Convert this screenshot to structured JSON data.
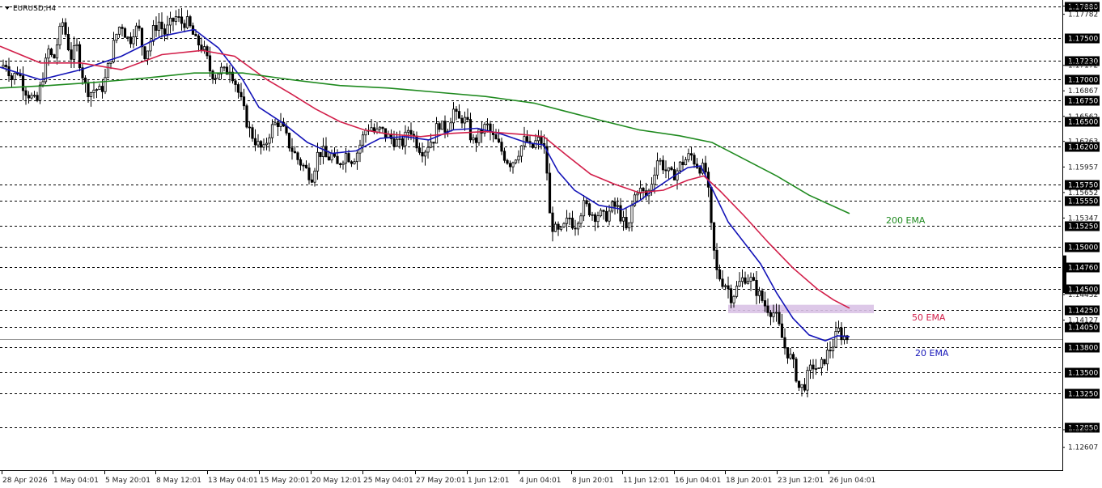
{
  "header": {
    "symbol_label": "EURUSD,H4",
    "menu_icon": "triangle-down-icon"
  },
  "colors": {
    "background": "#ffffff",
    "grid": "#000000",
    "candle": "#000000",
    "ema20": "#1414b8",
    "ema50": "#d21f4a",
    "ema200": "#1f8a1f",
    "zone": "#d9c2e6",
    "price_tag": "#000000",
    "current_price_line": "#9a9a9a"
  },
  "chart_data": {
    "type": "candlestick",
    "title": "",
    "xlabel": "",
    "ylabel": "",
    "symbol": "EURUSD",
    "timeframe": "H4",
    "ylim": [
      1.126,
      1.18
    ],
    "x_ticks": [
      "28 Apr 2026",
      "1 May 04:01",
      "5 May 20:01",
      "8 May 12:01",
      "13 May 04:01",
      "15 May 20:01",
      "20 May 12:01",
      "25 May 04:01",
      "27 May 20:01",
      "1 Jun 12:01",
      "4 Jun 04:01",
      "8 Jun 20:01",
      "11 Jun 12:01",
      "16 Jun 04:01",
      "18 Jun 20:01",
      "23 Jun 12:01",
      "26 Jun 04:01"
    ],
    "y_tick_labels": [
      "1.17880",
      "1.17782",
      "1.17172",
      "1.16867",
      "1.16562",
      "1.16263",
      "1.15957",
      "1.15652",
      "1.15347",
      "1.14432",
      "1.14127",
      "1.12817",
      "1.12607"
    ],
    "y_tick_values": [
      1.1788,
      1.17782,
      1.17172,
      1.16867,
      1.16562,
      1.16263,
      1.15957,
      1.15652,
      1.15347,
      1.14432,
      1.14127,
      1.12817,
      1.12607
    ],
    "levels": [
      1.1788,
      1.175,
      1.1723,
      1.17,
      1.1675,
      1.165,
      1.162,
      1.1575,
      1.1555,
      1.1525,
      1.15,
      1.1476,
      1.145,
      1.1425,
      1.1405,
      1.138,
      1.135,
      1.1325,
      1.1285
    ],
    "level_labels": [
      "1.17880",
      "1.17500",
      "1.17230",
      "1.17000",
      "1.16750",
      "1.16500",
      "1.16200",
      "1.15750",
      "1.15550",
      "1.15250",
      "1.15000",
      "1.14760",
      "1.14500",
      "1.14250",
      "1.14050",
      "1.13800",
      "1.13500",
      "1.13250",
      "1.12850"
    ],
    "current_price": 1.139,
    "resistance_zone": [
      1.1421,
      1.1431
    ],
    "close_path": [
      [
        0,
        1.1715
      ],
      [
        8,
        1.172
      ],
      [
        15,
        1.17
      ],
      [
        22,
        1.1712
      ],
      [
        30,
        1.169
      ],
      [
        38,
        1.168
      ],
      [
        45,
        1.167
      ],
      [
        52,
        1.17
      ],
      [
        60,
        1.1735
      ],
      [
        66,
        1.1722
      ],
      [
        72,
        1.175
      ],
      [
        78,
        1.177
      ],
      [
        83,
        1.1745
      ],
      [
        88,
        1.1728
      ],
      [
        95,
        1.1738
      ],
      [
        100,
        1.1715
      ],
      [
        106,
        1.169
      ],
      [
        112,
        1.1685
      ],
      [
        118,
        1.169
      ],
      [
        124,
        1.1685
      ],
      [
        130,
        1.17
      ],
      [
        135,
        1.172
      ],
      [
        140,
        1.174
      ],
      [
        145,
        1.1758
      ],
      [
        150,
        1.1768
      ],
      [
        155,
        1.1755
      ],
      [
        160,
        1.1745
      ],
      [
        166,
        1.1762
      ],
      [
        172,
        1.1758
      ],
      [
        178,
        1.173
      ],
      [
        184,
        1.174
      ],
      [
        190,
        1.176
      ],
      [
        196,
        1.177
      ],
      [
        203,
        1.1755
      ],
      [
        210,
        1.1765
      ],
      [
        217,
        1.1775
      ],
      [
        224,
        1.1768
      ],
      [
        230,
        1.177
      ],
      [
        236,
        1.176
      ],
      [
        242,
        1.1745
      ],
      [
        248,
        1.1742
      ],
      [
        254,
        1.173
      ],
      [
        260,
        1.171
      ],
      [
        266,
        1.1705
      ],
      [
        272,
        1.1712
      ],
      [
        278,
        1.1708
      ],
      [
        284,
        1.1715
      ],
      [
        290,
        1.17
      ],
      [
        296,
        1.168
      ],
      [
        302,
        1.166
      ],
      [
        308,
        1.164
      ],
      [
        314,
        1.163
      ],
      [
        320,
        1.162
      ],
      [
        326,
        1.1615
      ],
      [
        332,
        1.1635
      ],
      [
        338,
        1.1645
      ],
      [
        344,
        1.165
      ],
      [
        350,
        1.164
      ],
      [
        356,
        1.1625
      ],
      [
        362,
        1.1615
      ],
      [
        368,
        1.1605
      ],
      [
        374,
        1.1598
      ],
      [
        380,
        1.159
      ],
      [
        386,
        1.1585
      ],
      [
        392,
        1.161
      ],
      [
        398,
        1.1615
      ],
      [
        404,
        1.1605
      ],
      [
        410,
        1.161
      ],
      [
        416,
        1.1595
      ],
      [
        422,
        1.1605
      ],
      [
        428,
        1.1612
      ],
      [
        434,
        1.1605
      ],
      [
        440,
        1.161
      ],
      [
        446,
        1.1625
      ],
      [
        452,
        1.164
      ],
      [
        458,
        1.1645
      ],
      [
        464,
        1.1635
      ],
      [
        470,
        1.164
      ],
      [
        476,
        1.1635
      ],
      [
        482,
        1.163
      ],
      [
        488,
        1.1628
      ],
      [
        494,
        1.1622
      ],
      [
        500,
        1.1628
      ],
      [
        506,
        1.1645
      ],
      [
        512,
        1.163
      ],
      [
        518,
        1.162
      ],
      [
        524,
        1.1615
      ],
      [
        530,
        1.1625
      ],
      [
        536,
        1.163
      ],
      [
        542,
        1.165
      ],
      [
        548,
        1.164
      ],
      [
        554,
        1.1645
      ],
      [
        560,
        1.1665
      ],
      [
        566,
        1.165
      ],
      [
        572,
        1.1655
      ],
      [
        578,
        1.1645
      ],
      [
        584,
        1.1625
      ],
      [
        590,
        1.163
      ],
      [
        596,
        1.164
      ],
      [
        602,
        1.1645
      ],
      [
        608,
        1.1632
      ],
      [
        614,
        1.1625
      ],
      [
        620,
        1.1615
      ],
      [
        626,
        1.1605
      ],
      [
        632,
        1.16
      ],
      [
        638,
        1.161
      ],
      [
        644,
        1.162
      ],
      [
        650,
        1.163
      ],
      [
        656,
        1.1615
      ],
      [
        662,
        1.1625
      ],
      [
        668,
        1.1628
      ],
      [
        672,
        1.162
      ],
      [
        676,
        1.159
      ],
      [
        680,
        1.153
      ],
      [
        686,
        1.152
      ],
      [
        692,
        1.1515
      ],
      [
        698,
        1.1525
      ],
      [
        704,
        1.1535
      ],
      [
        710,
        1.1525
      ],
      [
        716,
        1.154
      ],
      [
        722,
        1.155
      ],
      [
        728,
        1.1545
      ],
      [
        734,
        1.1538
      ],
      [
        740,
        1.154
      ],
      [
        746,
        1.1535
      ],
      [
        752,
        1.154
      ],
      [
        758,
        1.155
      ],
      [
        764,
        1.1545
      ],
      [
        770,
        1.153
      ],
      [
        776,
        1.1515
      ],
      [
        782,
        1.1555
      ],
      [
        788,
        1.157
      ],
      [
        794,
        1.1565
      ],
      [
        800,
        1.156
      ],
      [
        806,
        1.158
      ],
      [
        812,
        1.1605
      ],
      [
        818,
        1.16
      ],
      [
        824,
        1.159
      ],
      [
        830,
        1.1585
      ],
      [
        836,
        1.159
      ],
      [
        842,
        1.16
      ],
      [
        848,
        1.1605
      ],
      [
        854,
        1.161
      ],
      [
        860,
        1.16
      ],
      [
        866,
        1.1595
      ],
      [
        872,
        1.159
      ],
      [
        876,
        1.156
      ],
      [
        880,
        1.151
      ],
      [
        886,
        1.147
      ],
      [
        892,
        1.146
      ],
      [
        898,
        1.1455
      ],
      [
        904,
        1.144
      ],
      [
        910,
        1.145
      ],
      [
        916,
        1.146
      ],
      [
        922,
        1.1465
      ],
      [
        928,
        1.146
      ],
      [
        934,
        1.145
      ],
      [
        940,
        1.144
      ],
      [
        946,
        1.143
      ],
      [
        952,
        1.1425
      ],
      [
        958,
        1.142
      ],
      [
        964,
        1.14
      ],
      [
        970,
        1.138
      ],
      [
        976,
        1.137
      ],
      [
        982,
        1.1355
      ],
      [
        988,
        1.133
      ],
      [
        994,
        1.1335
      ],
      [
        1000,
        1.135
      ],
      [
        1006,
        1.136
      ],
      [
        1012,
        1.135
      ],
      [
        1018,
        1.1365
      ],
      [
        1024,
        1.1375
      ],
      [
        1030,
        1.1385
      ],
      [
        1036,
        1.14
      ],
      [
        1040,
        1.1395
      ],
      [
        1046,
        1.1392
      ],
      [
        1050,
        1.139
      ]
    ],
    "series": [
      {
        "name": "20 EMA",
        "points": [
          [
            0,
            1.1715
          ],
          [
            50,
            1.17
          ],
          [
            100,
            1.1712
          ],
          [
            150,
            1.1728
          ],
          [
            200,
            1.1752
          ],
          [
            240,
            1.176
          ],
          [
            270,
            1.1738
          ],
          [
            300,
            1.17
          ],
          [
            320,
            1.1667
          ],
          [
            350,
            1.1648
          ],
          [
            380,
            1.1625
          ],
          [
            410,
            1.1612
          ],
          [
            440,
            1.1615
          ],
          [
            470,
            1.163
          ],
          [
            500,
            1.1632
          ],
          [
            530,
            1.1628
          ],
          [
            560,
            1.164
          ],
          [
            590,
            1.1642
          ],
          [
            620,
            1.1635
          ],
          [
            650,
            1.1625
          ],
          [
            672,
            1.1622
          ],
          [
            690,
            1.159
          ],
          [
            710,
            1.1568
          ],
          [
            740,
            1.155
          ],
          [
            770,
            1.1545
          ],
          [
            790,
            1.1555
          ],
          [
            810,
            1.157
          ],
          [
            830,
            1.1583
          ],
          [
            850,
            1.1595
          ],
          [
            866,
            1.1597
          ],
          [
            880,
            1.157
          ],
          [
            900,
            1.153
          ],
          [
            920,
            1.1505
          ],
          [
            940,
            1.148
          ],
          [
            960,
            1.1445
          ],
          [
            980,
            1.1415
          ],
          [
            1000,
            1.1395
          ],
          [
            1020,
            1.1388
          ],
          [
            1035,
            1.1394
          ],
          [
            1050,
            1.1393
          ]
        ]
      },
      {
        "name": "50 EMA",
        "points": [
          [
            0,
            1.174
          ],
          [
            50,
            1.172
          ],
          [
            100,
            1.172
          ],
          [
            150,
            1.1712
          ],
          [
            200,
            1.173
          ],
          [
            250,
            1.1735
          ],
          [
            290,
            1.1728
          ],
          [
            330,
            1.17
          ],
          [
            360,
            1.1683
          ],
          [
            390,
            1.1665
          ],
          [
            420,
            1.165
          ],
          [
            450,
            1.164
          ],
          [
            480,
            1.1635
          ],
          [
            520,
            1.1632
          ],
          [
            560,
            1.1636
          ],
          [
            600,
            1.1638
          ],
          [
            640,
            1.1635
          ],
          [
            672,
            1.1632
          ],
          [
            700,
            1.161
          ],
          [
            730,
            1.1587
          ],
          [
            760,
            1.1575
          ],
          [
            790,
            1.1565
          ],
          [
            820,
            1.1568
          ],
          [
            850,
            1.158
          ],
          [
            870,
            1.1585
          ],
          [
            890,
            1.1567
          ],
          [
            920,
            1.1537
          ],
          [
            950,
            1.1505
          ],
          [
            980,
            1.1475
          ],
          [
            1010,
            1.145
          ],
          [
            1030,
            1.1437
          ],
          [
            1050,
            1.1427
          ]
        ]
      },
      {
        "name": "200 EMA",
        "points": [
          [
            0,
            1.169
          ],
          [
            60,
            1.1693
          ],
          [
            120,
            1.1697
          ],
          [
            180,
            1.1702
          ],
          [
            240,
            1.1708
          ],
          [
            300,
            1.1708
          ],
          [
            360,
            1.17
          ],
          [
            420,
            1.1693
          ],
          [
            480,
            1.169
          ],
          [
            540,
            1.1685
          ],
          [
            600,
            1.168
          ],
          [
            660,
            1.1672
          ],
          [
            700,
            1.1662
          ],
          [
            740,
            1.1652
          ],
          [
            790,
            1.164
          ],
          [
            840,
            1.1633
          ],
          [
            880,
            1.1625
          ],
          [
            920,
            1.1605
          ],
          [
            960,
            1.1585
          ],
          [
            1000,
            1.1562
          ],
          [
            1050,
            1.154
          ]
        ]
      }
    ],
    "annotations": [
      {
        "text": "200 EMA",
        "series": "200 EMA"
      },
      {
        "text": "50 EMA",
        "series": "50 EMA"
      },
      {
        "text": "20 EMA",
        "series": "20 EMA"
      }
    ]
  }
}
